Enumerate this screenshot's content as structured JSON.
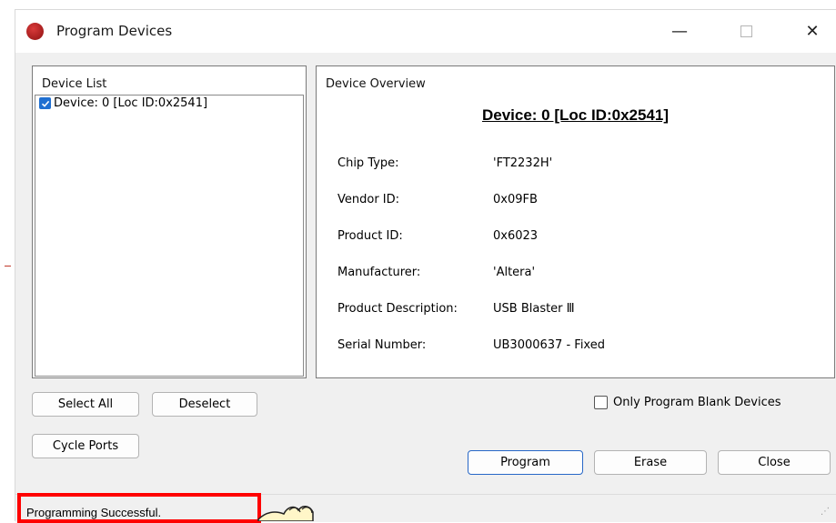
{
  "window": {
    "title": "Program Devices"
  },
  "device_list": {
    "title": "Device List",
    "items": [
      {
        "label": "Device: 0 [Loc ID:0x2541]",
        "checked": true
      }
    ]
  },
  "device_overview": {
    "title": "Device Overview",
    "heading": "Device: 0 [Loc ID:0x2541]",
    "rows": [
      {
        "label": "Chip Type:",
        "value": "'FT2232H'"
      },
      {
        "label": "Vendor ID:",
        "value": "0x09FB"
      },
      {
        "label": "Product ID:",
        "value": "0x6023"
      },
      {
        "label": "Manufacturer:",
        "value": "'Altera'"
      },
      {
        "label": "Product Description:",
        "value": "USB Blaster Ⅲ"
      },
      {
        "label": "Serial Number:",
        "value": "UB3000637 - Fixed"
      }
    ]
  },
  "buttons": {
    "select_all": "Select All",
    "deselect": "Deselect",
    "cycle_ports": "Cycle Ports",
    "program": "Program",
    "erase": "Erase",
    "close": "Close"
  },
  "options": {
    "only_blank": "Only Program Blank Devices"
  },
  "status": {
    "text": "Programming Successful."
  },
  "colors": {
    "accent": "#1f6fd1",
    "highlight": "#ff0000",
    "app_icon": "#b71c1c"
  },
  "icons": [
    "app-icon",
    "minimize-icon",
    "maximize-icon",
    "close-icon",
    "checkmark-icon",
    "pointing-hand-icon"
  ]
}
